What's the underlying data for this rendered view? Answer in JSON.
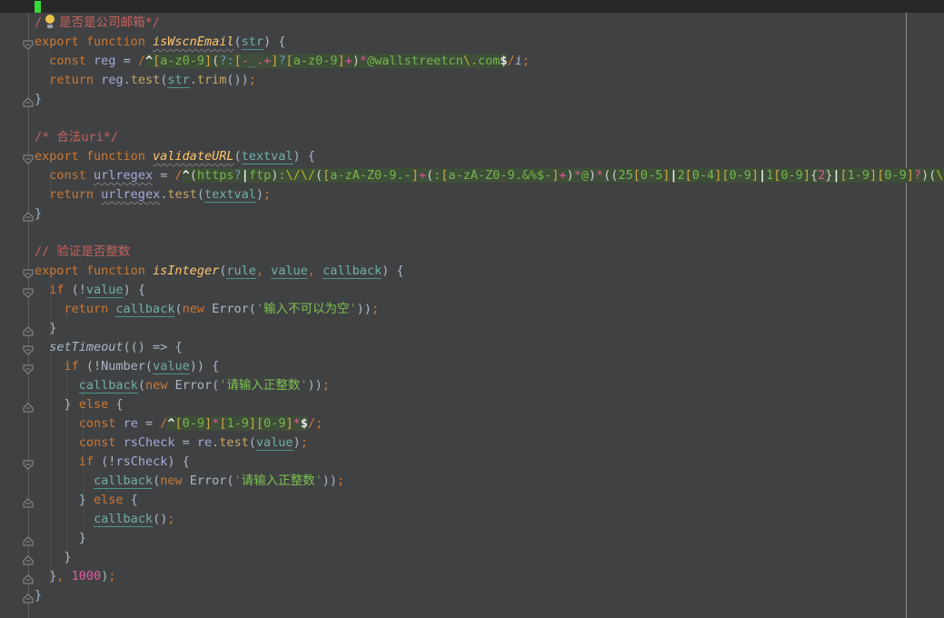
{
  "editor": {
    "background_color": "#404143",
    "caret_line_color": "#282828",
    "caret_color": "#36D936",
    "regex_injection_background": "#3E4E38",
    "right_margin_x": 997,
    "syntax_colors": {
      "keyword": "#CC7832",
      "function_declaration": "#FFC66D",
      "method_call": "#C8A862",
      "parameter": "#6FAFA7",
      "local_variable": "#A2AAD9",
      "comment": "#C4635A",
      "string": "#7CC24E",
      "number": "#DF5F9F",
      "default_text": "#A9B7C6"
    }
  },
  "lines": [
    {
      "fold": null,
      "tokens": [
        [
          "c",
          "/"
        ],
        [
          "bulb",
          ""
        ],
        [
          "c",
          "是否是公司邮箱*/"
        ]
      ]
    },
    {
      "fold": "down",
      "tokens": [
        [
          "k",
          "export function "
        ],
        [
          "d w",
          "isWscnEmail"
        ],
        [
          "t",
          "("
        ],
        [
          "p",
          "str"
        ],
        [
          "t",
          ") {"
        ]
      ]
    },
    {
      "fold": null,
      "tokens": [
        [
          "t",
          "  "
        ],
        [
          "k",
          "const"
        ],
        [
          "t",
          " "
        ],
        [
          "v",
          "reg"
        ],
        [
          "t",
          " = "
        ],
        [
          "k",
          "/"
        ],
        [
          "ra bg",
          "^"
        ],
        [
          "rb bg",
          "["
        ],
        [
          "rg bg",
          "a-z0-9"
        ],
        [
          "rb bg",
          "]"
        ],
        [
          "rt bg",
          "("
        ],
        [
          "rq bg",
          "?:"
        ],
        [
          "rb bg",
          "["
        ],
        [
          "rp bg",
          "-"
        ],
        [
          "rq bg",
          "_"
        ],
        [
          "rp bg",
          ".+"
        ],
        [
          "rb bg",
          "]"
        ],
        [
          "rq bg",
          "?"
        ],
        [
          "rb bg",
          "["
        ],
        [
          "rg bg",
          "a-z0-9"
        ],
        [
          "rb bg",
          "]"
        ],
        [
          "rp bg",
          "+"
        ],
        [
          "rt bg",
          ")"
        ],
        [
          "rp bg",
          "*"
        ],
        [
          "rg bg",
          "@wallstreetcn"
        ],
        [
          "re bg",
          "\\."
        ],
        [
          "rg bg",
          "com"
        ],
        [
          "ra bg",
          "$"
        ],
        [
          "k",
          "/"
        ],
        [
          "rf",
          "i"
        ],
        [
          "k",
          ";"
        ]
      ]
    },
    {
      "fold": null,
      "tokens": [
        [
          "t",
          "  "
        ],
        [
          "k",
          "return "
        ],
        [
          "v",
          "reg"
        ],
        [
          "t",
          "."
        ],
        [
          "m",
          "test"
        ],
        [
          "t",
          "("
        ],
        [
          "p",
          "str"
        ],
        [
          "t",
          "."
        ],
        [
          "m",
          "trim"
        ],
        [
          "t",
          "())"
        ],
        [
          "k",
          ";"
        ]
      ]
    },
    {
      "fold": "up",
      "tokens": [
        [
          "t",
          "}"
        ]
      ]
    },
    {
      "fold": null,
      "tokens": []
    },
    {
      "fold": null,
      "tokens": [
        [
          "c",
          "/* 合法uri*/"
        ]
      ]
    },
    {
      "fold": "down",
      "tokens": [
        [
          "k",
          "export function "
        ],
        [
          "d w",
          "validateURL"
        ],
        [
          "t",
          "("
        ],
        [
          "p",
          "textval"
        ],
        [
          "t",
          ") {"
        ]
      ]
    },
    {
      "fold": null,
      "tokens": [
        [
          "t",
          "  "
        ],
        [
          "k",
          "const"
        ],
        [
          "t",
          " "
        ],
        [
          "v w",
          "urlregex"
        ],
        [
          "t",
          " = "
        ],
        [
          "k",
          "/"
        ],
        [
          "ra bg",
          "^"
        ],
        [
          "rt bg",
          "("
        ],
        [
          "rg bg",
          "https"
        ],
        [
          "rq bg",
          "?"
        ],
        [
          "rx bg",
          "|"
        ],
        [
          "rg bg",
          "ftp"
        ],
        [
          "rt bg",
          ")"
        ],
        [
          "rg bg",
          ":"
        ],
        [
          "re bg",
          "\\/\\/"
        ],
        [
          "rt bg",
          "("
        ],
        [
          "rb bg",
          "["
        ],
        [
          "rg bg",
          "a-zA-Z0-9.-"
        ],
        [
          "rb bg",
          "]"
        ],
        [
          "rp bg",
          "+"
        ],
        [
          "rt bg",
          "("
        ],
        [
          "rg bg",
          ":"
        ],
        [
          "rb bg",
          "["
        ],
        [
          "rg bg",
          "a-zA-Z0-9.&%$-"
        ],
        [
          "rb bg",
          "]"
        ],
        [
          "rp bg",
          "+"
        ],
        [
          "rt bg",
          ")"
        ],
        [
          "rp bg",
          "*"
        ],
        [
          "rg bg",
          "@"
        ],
        [
          "rt bg",
          ")"
        ],
        [
          "rp bg",
          "*"
        ],
        [
          "rt bg",
          "(("
        ],
        [
          "rg bg",
          "25"
        ],
        [
          "rb bg",
          "["
        ],
        [
          "rg bg",
          "0-5"
        ],
        [
          "rb bg",
          "]"
        ],
        [
          "rx bg",
          "|"
        ],
        [
          "rg bg",
          "2"
        ],
        [
          "rb bg",
          "["
        ],
        [
          "rg bg",
          "0-4"
        ],
        [
          "rb bg",
          "]"
        ],
        [
          "rb bg",
          "["
        ],
        [
          "rg bg",
          "0-9"
        ],
        [
          "rb bg",
          "]"
        ],
        [
          "rx bg",
          "|"
        ],
        [
          "rg bg",
          "1"
        ],
        [
          "rb bg",
          "["
        ],
        [
          "rg bg",
          "0-9"
        ],
        [
          "rb bg",
          "]"
        ],
        [
          "rt bg",
          "{"
        ],
        [
          "rp bg",
          "2"
        ],
        [
          "rt bg",
          "}"
        ],
        [
          "rx bg",
          "|"
        ],
        [
          "rb bg",
          "["
        ],
        [
          "rg bg",
          "1-9"
        ],
        [
          "rb bg",
          "]"
        ],
        [
          "rb bg",
          "["
        ],
        [
          "rg bg",
          "0-9"
        ],
        [
          "rb bg",
          "]"
        ],
        [
          "rp bg",
          "?"
        ],
        [
          "rt bg",
          ")"
        ],
        [
          "rt bg",
          "("
        ],
        [
          "re bg",
          "\\."
        ],
        [
          "rt bg",
          "("
        ]
      ]
    },
    {
      "fold": null,
      "tokens": [
        [
          "t",
          "  "
        ],
        [
          "k",
          "return "
        ],
        [
          "v w",
          "urlregex"
        ],
        [
          "t",
          "."
        ],
        [
          "m",
          "test"
        ],
        [
          "t",
          "("
        ],
        [
          "p",
          "textval"
        ],
        [
          "t",
          ")"
        ],
        [
          "k",
          ";"
        ]
      ]
    },
    {
      "fold": "up",
      "tokens": [
        [
          "t",
          "}"
        ]
      ]
    },
    {
      "fold": null,
      "tokens": []
    },
    {
      "fold": null,
      "tokens": [
        [
          "c",
          "// 验证是否整数"
        ]
      ]
    },
    {
      "fold": "down",
      "tokens": [
        [
          "k",
          "export function "
        ],
        [
          "d",
          "isInteger"
        ],
        [
          "t",
          "("
        ],
        [
          "p",
          "rule"
        ],
        [
          "k",
          ","
        ],
        [
          "t",
          " "
        ],
        [
          "p",
          "value"
        ],
        [
          "k",
          ","
        ],
        [
          "t",
          " "
        ],
        [
          "p",
          "callback"
        ],
        [
          "t",
          ") {"
        ]
      ]
    },
    {
      "fold": "down",
      "tokens": [
        [
          "t",
          "  "
        ],
        [
          "k",
          "if"
        ],
        [
          "t",
          " (!"
        ],
        [
          "p",
          "value"
        ],
        [
          "t",
          ") {"
        ]
      ]
    },
    {
      "fold": null,
      "tokens": [
        [
          "t",
          "    "
        ],
        [
          "k",
          "return "
        ],
        [
          "p",
          "callback"
        ],
        [
          "t",
          "("
        ],
        [
          "k",
          "new"
        ],
        [
          "t",
          " Error("
        ],
        [
          "q",
          "'"
        ],
        [
          "s",
          "输入不可以为空"
        ],
        [
          "q",
          "'"
        ],
        [
          "t",
          "))"
        ],
        [
          "k",
          ";"
        ]
      ]
    },
    {
      "fold": "up",
      "tokens": [
        [
          "t",
          "  }"
        ]
      ]
    },
    {
      "fold": "down",
      "tokens": [
        [
          "t",
          "  "
        ],
        [
          "i",
          "setTimeout"
        ],
        [
          "t",
          "(() => {"
        ]
      ]
    },
    {
      "fold": "down",
      "tokens": [
        [
          "t",
          "    "
        ],
        [
          "k",
          "if"
        ],
        [
          "t",
          " (!Number("
        ],
        [
          "p",
          "value"
        ],
        [
          "t",
          ")) {"
        ]
      ]
    },
    {
      "fold": null,
      "tokens": [
        [
          "t",
          "      "
        ],
        [
          "p",
          "callback"
        ],
        [
          "t",
          "("
        ],
        [
          "k",
          "new"
        ],
        [
          "t",
          " Error("
        ],
        [
          "q",
          "'"
        ],
        [
          "s",
          "请输入正整数"
        ],
        [
          "q",
          "'"
        ],
        [
          "t",
          "))"
        ],
        [
          "k",
          ";"
        ]
      ]
    },
    {
      "fold": "up",
      "tokens": [
        [
          "t",
          "    } "
        ],
        [
          "k",
          "else"
        ],
        [
          "t",
          " {"
        ]
      ]
    },
    {
      "fold": null,
      "tokens": [
        [
          "t",
          "      "
        ],
        [
          "k",
          "const"
        ],
        [
          "t",
          " "
        ],
        [
          "v",
          "re"
        ],
        [
          "t",
          " = "
        ],
        [
          "k",
          "/"
        ],
        [
          "ra bg",
          "^"
        ],
        [
          "rb bg",
          "["
        ],
        [
          "rg bg",
          "0-9"
        ],
        [
          "rb bg",
          "]"
        ],
        [
          "rp bg",
          "*"
        ],
        [
          "rb bg",
          "["
        ],
        [
          "rg bg",
          "1-9"
        ],
        [
          "rb bg",
          "]"
        ],
        [
          "rb bg",
          "["
        ],
        [
          "rg bg",
          "0-9"
        ],
        [
          "rb bg",
          "]"
        ],
        [
          "rp bg",
          "*"
        ],
        [
          "ra bg",
          "$"
        ],
        [
          "k",
          "/"
        ],
        [
          "k",
          ";"
        ]
      ]
    },
    {
      "fold": null,
      "tokens": [
        [
          "t",
          "      "
        ],
        [
          "k",
          "const"
        ],
        [
          "t",
          " "
        ],
        [
          "v",
          "rsCheck"
        ],
        [
          "t",
          " = "
        ],
        [
          "v",
          "re"
        ],
        [
          "t",
          "."
        ],
        [
          "m",
          "test"
        ],
        [
          "t",
          "("
        ],
        [
          "p",
          "value"
        ],
        [
          "t",
          ")"
        ],
        [
          "k",
          ";"
        ]
      ]
    },
    {
      "fold": "down",
      "tokens": [
        [
          "t",
          "      "
        ],
        [
          "k",
          "if"
        ],
        [
          "t",
          " (!"
        ],
        [
          "v",
          "rsCheck"
        ],
        [
          "t",
          ") {"
        ]
      ]
    },
    {
      "fold": null,
      "tokens": [
        [
          "t",
          "        "
        ],
        [
          "p",
          "callback"
        ],
        [
          "t",
          "("
        ],
        [
          "k",
          "new"
        ],
        [
          "t",
          " Error("
        ],
        [
          "q",
          "'"
        ],
        [
          "s",
          "请输入正整数"
        ],
        [
          "q",
          "'"
        ],
        [
          "t",
          "))"
        ],
        [
          "k",
          ";"
        ]
      ]
    },
    {
      "fold": "up",
      "tokens": [
        [
          "t",
          "      } "
        ],
        [
          "k",
          "else"
        ],
        [
          "t",
          " {"
        ]
      ]
    },
    {
      "fold": null,
      "tokens": [
        [
          "t",
          "        "
        ],
        [
          "p",
          "callback"
        ],
        [
          "t",
          "()"
        ],
        [
          "k",
          ";"
        ]
      ]
    },
    {
      "fold": "up",
      "tokens": [
        [
          "t",
          "      }"
        ]
      ]
    },
    {
      "fold": "up",
      "tokens": [
        [
          "t",
          "    }"
        ]
      ]
    },
    {
      "fold": "up",
      "tokens": [
        [
          "t",
          "  }"
        ],
        [
          "k",
          ","
        ],
        [
          "t",
          " "
        ],
        [
          "n",
          "1000"
        ],
        [
          "t",
          ")"
        ],
        [
          "k",
          ";"
        ]
      ]
    },
    {
      "fold": "up",
      "tokens": [
        [
          "t",
          "}"
        ]
      ]
    }
  ]
}
